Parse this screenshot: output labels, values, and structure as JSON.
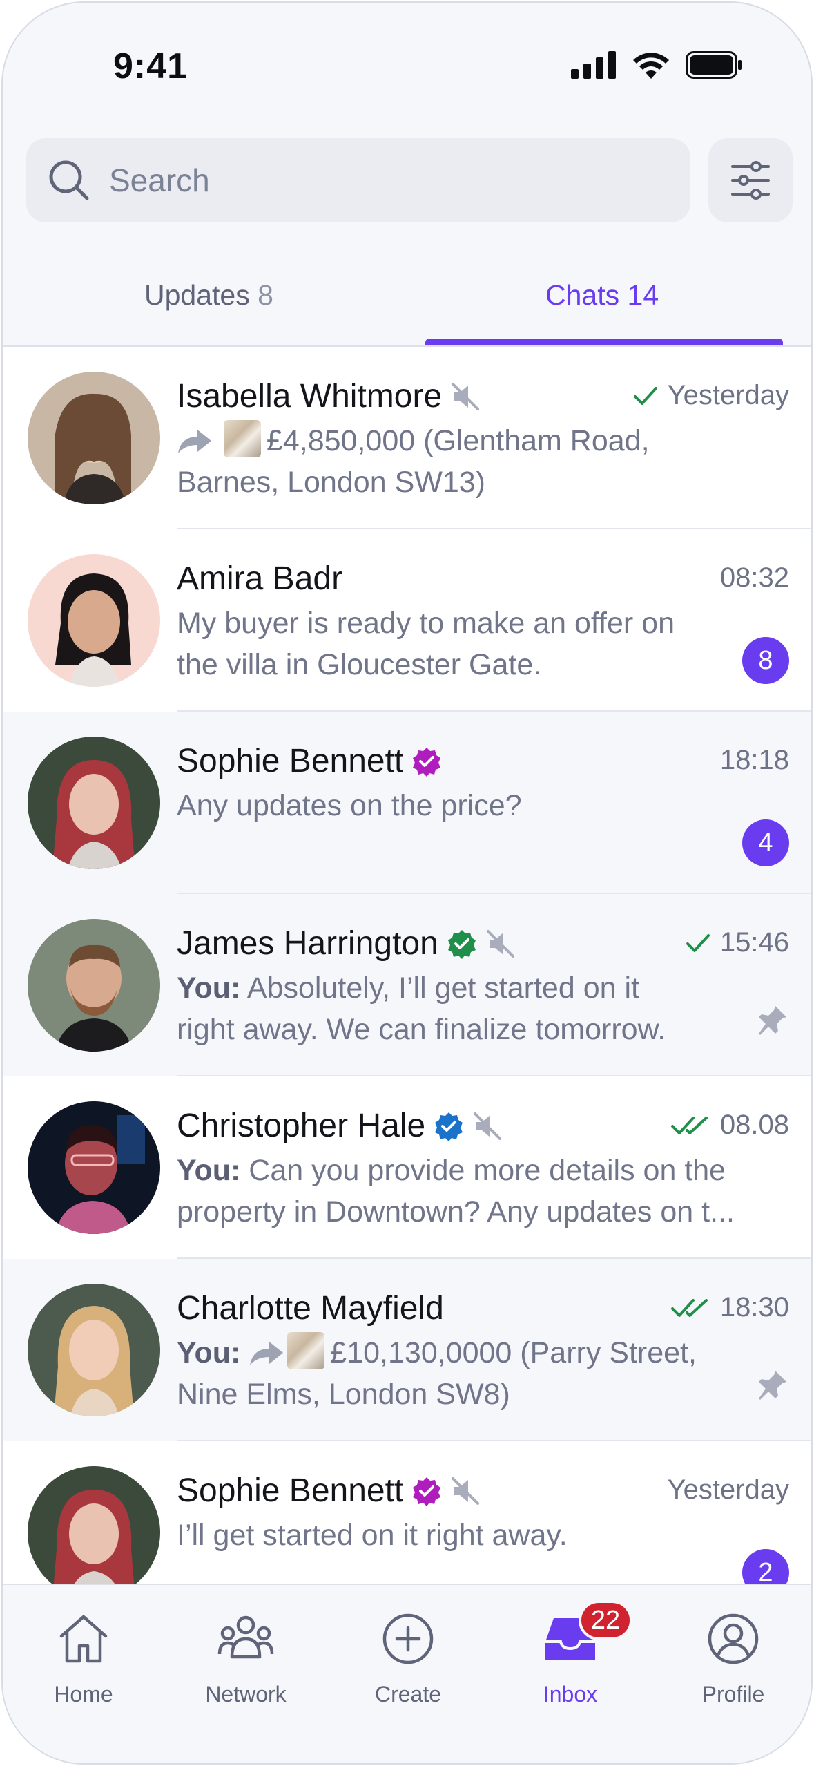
{
  "status_bar": {
    "time": "9:41"
  },
  "search": {
    "placeholder": "Search"
  },
  "tabs": [
    {
      "label": "Updates",
      "count": "8"
    },
    {
      "label": "Chats",
      "count": "14"
    }
  ],
  "chats": [
    {
      "name": "Isabella Whitmore",
      "verified": null,
      "muted": true,
      "status": "sent",
      "time": "Yesterday",
      "forwarded": true,
      "has_thumbnail": true,
      "message": "£4,850,000 (Glentham Road, Barnes, London SW13)",
      "unread": null,
      "pinned": false
    },
    {
      "name": "Amira Badr",
      "verified": null,
      "muted": false,
      "status": null,
      "time": "08:32",
      "message": "My buyer is ready to make an offer on the villa in Gloucester Gate.",
      "unread": "8",
      "pinned": false
    },
    {
      "name": "Sophie Bennett",
      "verified": "purple",
      "muted": false,
      "status": null,
      "time": "18:18",
      "message": "Any updates on the price?",
      "unread": "4",
      "pinned": false
    },
    {
      "name": "James Harrington",
      "verified": "green",
      "muted": true,
      "status": "sent",
      "time": "15:46",
      "prefix": "You:",
      "message": "Absolutely, I’ll get started on it right away. We can finalize tomorrow.",
      "unread": null,
      "pinned": true
    },
    {
      "name": "Christopher Hale",
      "verified": "blue",
      "muted": true,
      "status": "read",
      "time": "08.08",
      "prefix": "You:",
      "message_line1": "Can you provide more details on the",
      "message_line2": "property in Downtown? Any updates on t...",
      "unread": null,
      "pinned": false
    },
    {
      "name": "Charlotte Mayfield",
      "verified": null,
      "muted": false,
      "status": "read",
      "time": "18:30",
      "prefix": "You:",
      "forwarded": true,
      "has_thumbnail": true,
      "message_line1": "£10,130,0000 (Parry Street,",
      "message_line2": "Nine Elms, London SW8)",
      "unread": null,
      "pinned": true
    },
    {
      "name": "Sophie Bennett",
      "verified": "purple",
      "muted": true,
      "status": null,
      "time": "Yesterday",
      "message": "I’ll get started on it right away.",
      "unread": "2",
      "pinned": false
    }
  ],
  "bottom_nav": {
    "items": [
      {
        "label": "Home",
        "icon": "home-icon"
      },
      {
        "label": "Network",
        "icon": "people-icon"
      },
      {
        "label": "Create",
        "icon": "plus-circle-icon"
      },
      {
        "label": "Inbox",
        "icon": "inbox-icon",
        "badge": "22"
      },
      {
        "label": "Profile",
        "icon": "user-icon"
      }
    ],
    "active": "Inbox"
  },
  "colors": {
    "accent": "#6a3cf0",
    "badge_red": "#d0232f",
    "verified_purple": "#b01dbd",
    "verified_green": "#1f8f4a",
    "verified_blue": "#1a73c9",
    "check_green": "#1f8f4a"
  }
}
